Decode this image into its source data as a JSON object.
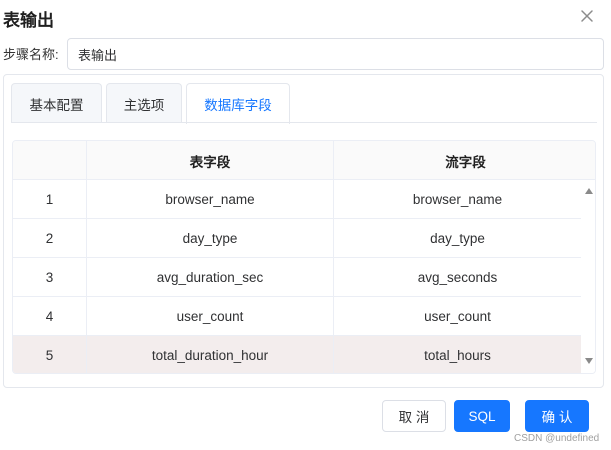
{
  "dialog": {
    "title": "表输出",
    "close_icon": "close-icon"
  },
  "step": {
    "label": "步骤名称:",
    "value": "表输出"
  },
  "tabs": [
    {
      "label": "基本配置",
      "active": false
    },
    {
      "label": "主选项",
      "active": false
    },
    {
      "label": "数据库字段",
      "active": true
    }
  ],
  "table": {
    "columns": [
      "",
      "表字段",
      "流字段"
    ],
    "rows": [
      {
        "index": "1",
        "table_field": "browser_name",
        "stream_field": "browser_name",
        "selected": false
      },
      {
        "index": "2",
        "table_field": "day_type",
        "stream_field": "day_type",
        "selected": false
      },
      {
        "index": "3",
        "table_field": "avg_duration_sec",
        "stream_field": "avg_seconds",
        "selected": false
      },
      {
        "index": "4",
        "table_field": "user_count",
        "stream_field": "user_count",
        "selected": false
      },
      {
        "index": "5",
        "table_field": "total_duration_hour",
        "stream_field": "total_hours",
        "selected": true
      }
    ]
  },
  "buttons": {
    "cancel": "取 消",
    "sql": "SQL",
    "confirm": "确 认"
  },
  "watermark": "CSDN @undefined",
  "colors": {
    "accent": "#1677ff",
    "selected_row": "#f3eded"
  }
}
